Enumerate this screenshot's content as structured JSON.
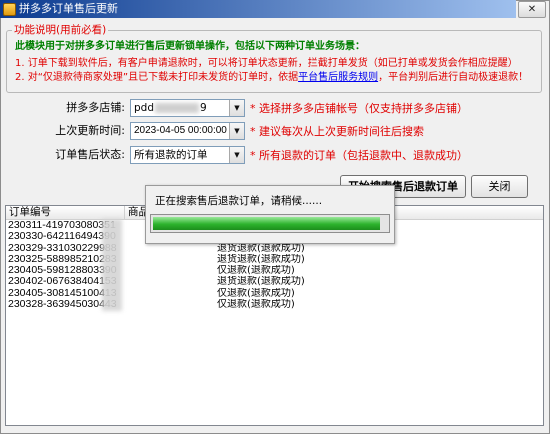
{
  "window": {
    "title": "拼多多订单售后更新",
    "close_glyph": "✕"
  },
  "instructions": {
    "legend": "功能说明(用前必看)",
    "headline": "此模块用于对拼多多订单进行售后更新锁单操作，包括以下两种订单业务场景：",
    "item1": "1. 订单下载到软件后，有客户申请退款时，可以将订单状态更新，拦截打单发货（如已打单或发货会作相应提醒）",
    "item2_before": "2. 对“仅退款待商家处理”且已下载未打印未发货的订单时，依据",
    "item2_link": "平台售后服务规则",
    "item2_after": "，平台判别后进行自动极速退款！"
  },
  "form": {
    "store": {
      "label": "拼多多店铺:",
      "value_start": "pdd",
      "value_end": "9",
      "hint": "* 选择拼多多店铺帐号（仅支持拼多多店铺）"
    },
    "last_update": {
      "label": "上次更新时间:",
      "value": "2023-04-05 00:00:00",
      "hint": "* 建议每次从上次更新时间往后搜索"
    },
    "aftersale_status": {
      "label": "订单售后状态:",
      "value": "所有退款的订单",
      "hint": "* 所有退款的订单（包括退款中、退款成功）"
    },
    "dropdown_glyph": "▼"
  },
  "buttons": {
    "start": "开始搜索售后退款订单",
    "close": "关闭"
  },
  "table": {
    "columns": [
      "订单编号",
      "商品"
    ],
    "rows": [
      {
        "id": "230311-419703080351"
      },
      {
        "id": "230330-642116494390"
      },
      {
        "id": "230329-331030229988",
        "status": "退货退款(退款成功)"
      },
      {
        "id": "230325-588985210283",
        "status": "退货退款(退款成功)"
      },
      {
        "id": "230405-598128803390",
        "status": "仅退款(退款成功)"
      },
      {
        "id": "230402-067638404153",
        "status": "退货退款(退款成功)"
      },
      {
        "id": "230405-308145100413",
        "status": "仅退款(退款成功)"
      },
      {
        "id": "230328-363945030443",
        "status": "仅退款(退款成功)"
      }
    ]
  },
  "progress": {
    "message": "正在搜索售后退款订单，请稍候......",
    "value": 0.97
  },
  "colors": {
    "title_bar_start": "#0b3a8f",
    "title_bar_end": "#9fc0ee",
    "hint_red": "#e00000",
    "headline_green": "#008000",
    "link_blue": "#0000ee",
    "progress_green": "#2db32d"
  }
}
